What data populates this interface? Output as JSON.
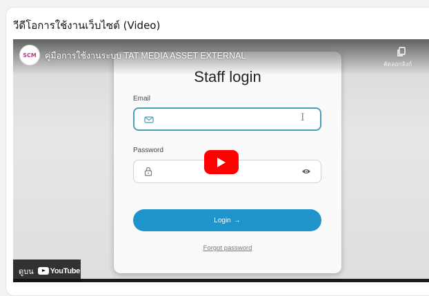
{
  "section": {
    "title": "วีดีโอการใช้งานเว็บไซต์ (Video)"
  },
  "video": {
    "channel_avatar_text": "SCM",
    "title": "คู่มือการใช้งานระบบ TAT MEDIA ASSET EXTERNAL",
    "copy_link_label": "คัดลอกลิงก์",
    "watch_on_label": "ดูบน",
    "youtube_label": "YouTube",
    "icons": {
      "copy": "copy-icon",
      "play": "play-icon",
      "youtube": "youtube-logo-icon"
    },
    "colors": {
      "play_button": "#ff0000",
      "login_button": "#1f93cc",
      "email_focus_border": "#4aa0b8"
    }
  },
  "login_form": {
    "heading": "Staff login",
    "email_label": "Email",
    "password_label": "Password",
    "login_button_label": "Login",
    "login_button_arrow": "→",
    "forgot_password_label": "Forgot password",
    "icons": {
      "email": "mail-icon",
      "password": "lock-icon",
      "toggle_visibility": "eye-icon",
      "text_cursor": "text-cursor-icon"
    }
  }
}
